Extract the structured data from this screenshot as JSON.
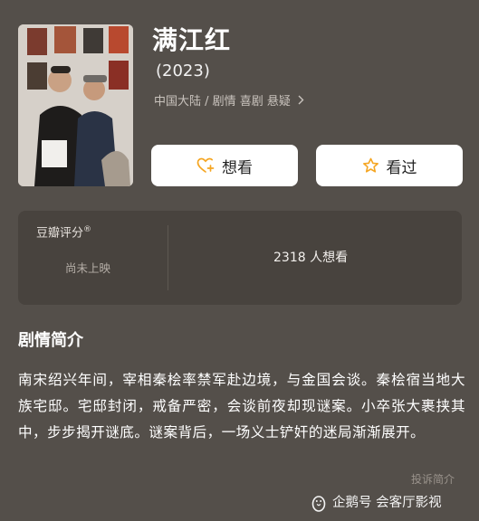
{
  "movie": {
    "title": "满江红",
    "year": "(2023)",
    "meta": "中国大陆 / 剧情 喜剧 悬疑"
  },
  "actions": {
    "want_label": "想看",
    "seen_label": "看过"
  },
  "rating": {
    "label": "豆瓣评分",
    "registered_mark": "®",
    "status": "尚未上映",
    "want_count": "2318 人想看"
  },
  "synopsis": {
    "heading": "剧情简介",
    "text": "南宋绍兴年间，宰相秦桧率禁军赴边境，与金国会谈。秦桧宿当地大族宅邸。宅邸封闭，戒备严密，会谈前夜却现谜案。小卒张大裹挟其中，步步揭开谜底。谜案背后，一场义士铲奸的迷局渐渐展开。"
  },
  "footer": {
    "complain": "投诉简介",
    "watermark": "企鹅号 会客厅影视"
  },
  "colors": {
    "background": "#544f4a",
    "card": "#48433e",
    "star_accent": "#f5a623"
  },
  "icons": {
    "want": "heart-plus-icon",
    "seen": "star-outline-icon",
    "meta_more": "chevron-right-icon",
    "watermark": "penguin-icon"
  }
}
